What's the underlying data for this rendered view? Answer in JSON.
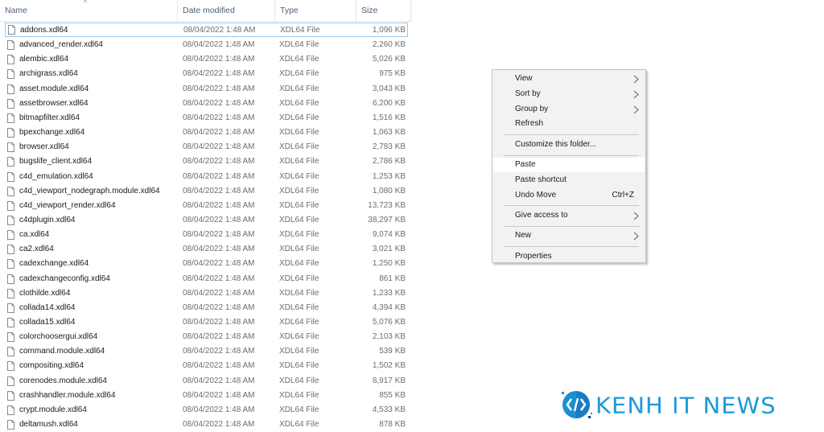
{
  "columns": {
    "name": "Name",
    "date": "Date modified",
    "type": "Type",
    "size": "Size",
    "sort_indicator": "^"
  },
  "files": [
    {
      "name": "addons.xdl64",
      "date": "08/04/2022 1:48 AM",
      "type": "XDL64 File",
      "size": "1,096 KB",
      "focused": true
    },
    {
      "name": "advanced_render.xdl64",
      "date": "08/04/2022 1:48 AM",
      "type": "XDL64 File",
      "size": "2,260 KB"
    },
    {
      "name": "alembic.xdl64",
      "date": "08/04/2022 1:48 AM",
      "type": "XDL64 File",
      "size": "5,026 KB"
    },
    {
      "name": "archigrass.xdl64",
      "date": "08/04/2022 1:48 AM",
      "type": "XDL64 File",
      "size": "975 KB"
    },
    {
      "name": "asset.module.xdl64",
      "date": "08/04/2022 1:48 AM",
      "type": "XDL64 File",
      "size": "3,043 KB"
    },
    {
      "name": "assetbrowser.xdl64",
      "date": "08/04/2022 1:48 AM",
      "type": "XDL64 File",
      "size": "6,200 KB"
    },
    {
      "name": "bitmapfilter.xdl64",
      "date": "08/04/2022 1:48 AM",
      "type": "XDL64 File",
      "size": "1,516 KB"
    },
    {
      "name": "bpexchange.xdl64",
      "date": "08/04/2022 1:48 AM",
      "type": "XDL64 File",
      "size": "1,063 KB"
    },
    {
      "name": "browser.xdl64",
      "date": "08/04/2022 1:48 AM",
      "type": "XDL64 File",
      "size": "2,783 KB"
    },
    {
      "name": "bugslife_client.xdl64",
      "date": "08/04/2022 1:48 AM",
      "type": "XDL64 File",
      "size": "2,786 KB"
    },
    {
      "name": "c4d_emulation.xdl64",
      "date": "08/04/2022 1:48 AM",
      "type": "XDL64 File",
      "size": "1,253 KB"
    },
    {
      "name": "c4d_viewport_nodegraph.module.xdl64",
      "date": "08/04/2022 1:48 AM",
      "type": "XDL64 File",
      "size": "1,080 KB"
    },
    {
      "name": "c4d_viewport_render.xdl64",
      "date": "08/04/2022 1:48 AM",
      "type": "XDL64 File",
      "size": "13,723 KB"
    },
    {
      "name": "c4dplugin.xdl64",
      "date": "08/04/2022 1:48 AM",
      "type": "XDL64 File",
      "size": "38,297 KB"
    },
    {
      "name": "ca.xdl64",
      "date": "08/04/2022 1:48 AM",
      "type": "XDL64 File",
      "size": "9,074 KB"
    },
    {
      "name": "ca2.xdl64",
      "date": "08/04/2022 1:48 AM",
      "type": "XDL64 File",
      "size": "3,021 KB"
    },
    {
      "name": "cadexchange.xdl64",
      "date": "08/04/2022 1:48 AM",
      "type": "XDL64 File",
      "size": "1,250 KB"
    },
    {
      "name": "cadexchangeconfig.xdl64",
      "date": "08/04/2022 1:48 AM",
      "type": "XDL64 File",
      "size": "861 KB"
    },
    {
      "name": "clothilde.xdl64",
      "date": "08/04/2022 1:48 AM",
      "type": "XDL64 File",
      "size": "1,233 KB"
    },
    {
      "name": "collada14.xdl64",
      "date": "08/04/2022 1:48 AM",
      "type": "XDL64 File",
      "size": "4,394 KB"
    },
    {
      "name": "collada15.xdl64",
      "date": "08/04/2022 1:48 AM",
      "type": "XDL64 File",
      "size": "5,076 KB"
    },
    {
      "name": "colorchoosergui.xdl64",
      "date": "08/04/2022 1:48 AM",
      "type": "XDL64 File",
      "size": "2,103 KB"
    },
    {
      "name": "command.module.xdl64",
      "date": "08/04/2022 1:48 AM",
      "type": "XDL64 File",
      "size": "539 KB"
    },
    {
      "name": "compositing.xdl64",
      "date": "08/04/2022 1:48 AM",
      "type": "XDL64 File",
      "size": "1,502 KB"
    },
    {
      "name": "corenodes.module.xdl64",
      "date": "08/04/2022 1:48 AM",
      "type": "XDL64 File",
      "size": "8,917 KB"
    },
    {
      "name": "crashhandler.module.xdl64",
      "date": "08/04/2022 1:48 AM",
      "type": "XDL64 File",
      "size": "855 KB"
    },
    {
      "name": "crypt.module.xdl64",
      "date": "08/04/2022 1:48 AM",
      "type": "XDL64 File",
      "size": "4,533 KB"
    },
    {
      "name": "deltamush.xdl64",
      "date": "08/04/2022 1:48 AM",
      "type": "XDL64 File",
      "size": "878 KB"
    }
  ],
  "context_menu": {
    "groups": [
      [
        {
          "label": "View",
          "submenu": true,
          "icon": "chevron-right-icon"
        },
        {
          "label": "Sort by",
          "submenu": true,
          "icon": "chevron-right-icon"
        },
        {
          "label": "Group by",
          "submenu": true,
          "icon": "chevron-right-icon"
        },
        {
          "label": "Refresh"
        }
      ],
      [
        {
          "label": "Customize this folder..."
        }
      ],
      [
        {
          "label": "Paste",
          "highlighted": true
        },
        {
          "label": "Paste shortcut"
        },
        {
          "label": "Undo Move",
          "shortcut": "Ctrl+Z"
        }
      ],
      [
        {
          "label": "Give access to",
          "submenu": true,
          "icon": "chevron-right-icon"
        }
      ],
      [
        {
          "label": "New",
          "submenu": true,
          "icon": "chevron-right-icon"
        }
      ],
      [
        {
          "label": "Properties"
        }
      ]
    ]
  },
  "watermark": {
    "text": "KENH IT NEWS",
    "icon": "code-brackets-icon",
    "color": "#1b9ad6"
  }
}
